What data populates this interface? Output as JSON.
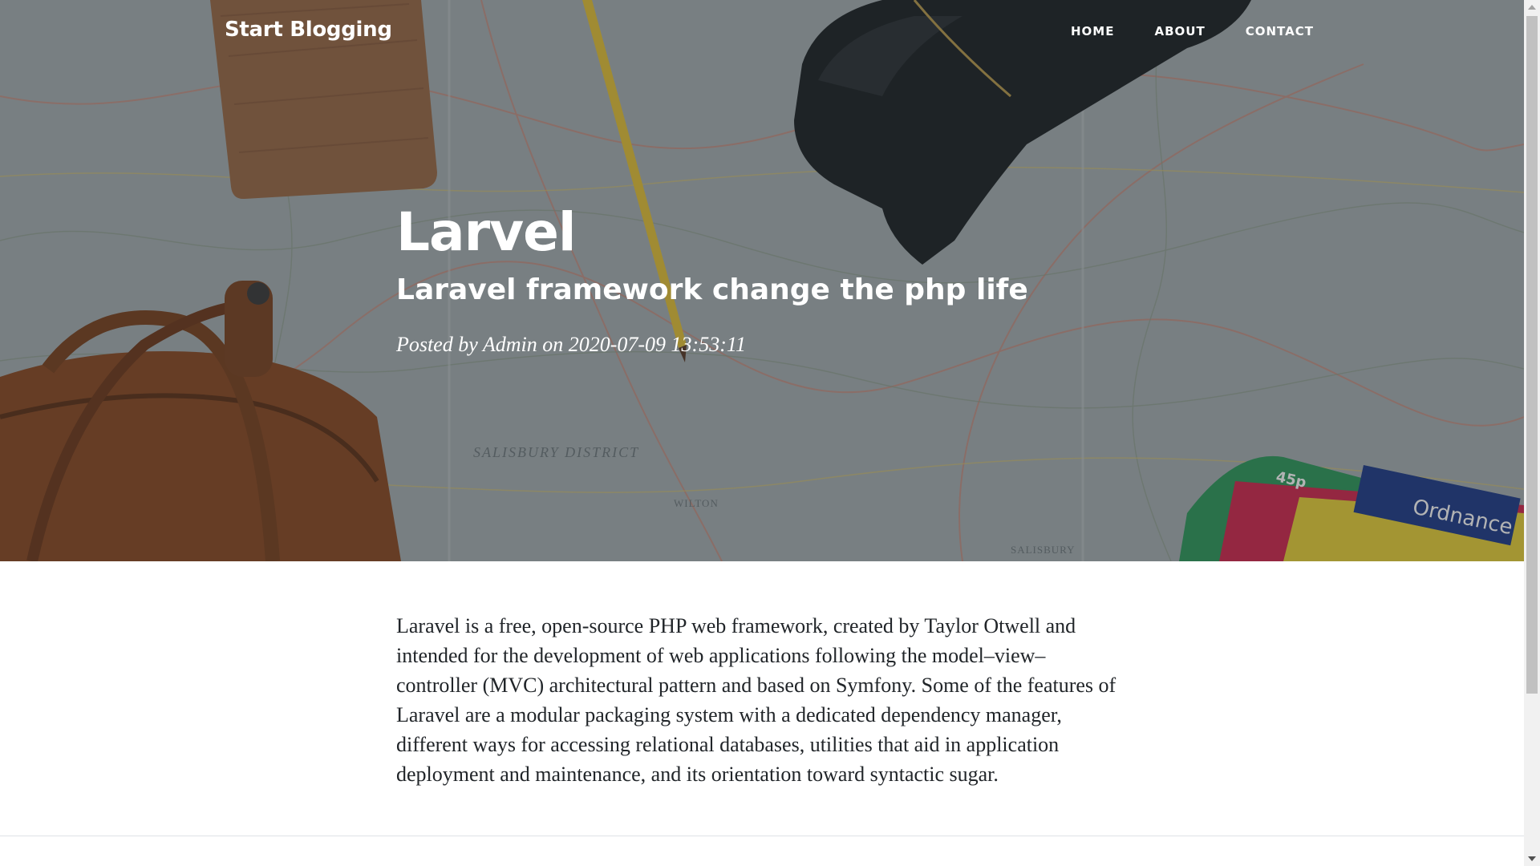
{
  "navbar": {
    "brand": "Start Blogging",
    "links": [
      {
        "label": "HOME"
      },
      {
        "label": "ABOUT"
      },
      {
        "label": "CONTACT"
      }
    ]
  },
  "post": {
    "title": "Larvel",
    "subtitle": "Laravel framework change the php life",
    "meta_prefix": "Posted by",
    "author": "Admin",
    "meta_on": "on",
    "date": "2020-07-09 13:53:11",
    "body": "Laravel is a free, open-source PHP web framework, created by Taylor Otwell and intended for the development of web applications following the model–view–controller (MVC) architectural pattern and based on Symfony. Some of the features of Laravel are a modular packaging system with a dedicated dependency manager, different ways for accessing relational databases, utilities that aid in application deployment and maintenance, and its orientation toward syntactic sugar."
  },
  "hero_image": {
    "map_labels": [
      "SALISBURY DISTRICT",
      "WILTON",
      "SALISBURY"
    ],
    "book_label": "Ordnance",
    "price_label": "45p"
  },
  "colors": {
    "text_dark": "#212529",
    "white": "#ffffff",
    "overlay": "#212529",
    "divider": "#dee2e6",
    "scroll_thumb": "#c1c1c1"
  }
}
